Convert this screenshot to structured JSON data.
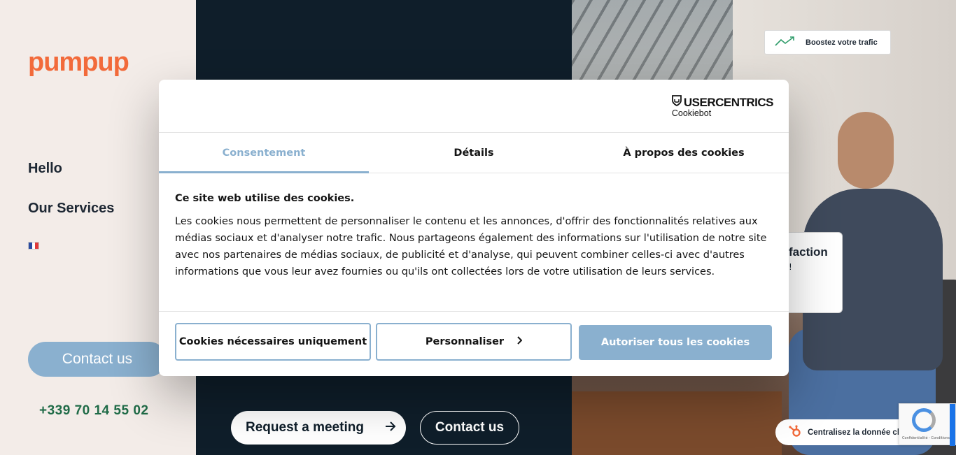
{
  "sidebar": {
    "logo": "pumpup",
    "nav": [
      "Hello",
      "Our Services"
    ],
    "contact_label": "Contact us",
    "phone": "+339 70 14 55 02"
  },
  "hero": {
    "request_meeting_label": "Request a meeting",
    "contact_label": "Contact us"
  },
  "photo_overlays": {
    "trafic_badge": "Boostez votre trafic",
    "satisfaction_title": "faction",
    "satisfaction_sub": "!",
    "centralisez_badge": "Centralisez la donnée cl",
    "recaptcha_text": "Confidentialité - Conditions"
  },
  "cookie_dialog": {
    "brand": "USERCENTRICS",
    "brand_sub": "Cookiebot",
    "tabs": [
      "Consentement",
      "Détails",
      "À propos des cookies"
    ],
    "title": "Ce site web utilise des cookies.",
    "body": "Les cookies nous permettent de personnaliser le contenu et les annonces, d'offrir des fonctionnalités relatives aux médias sociaux et d'analyser notre trafic. Nous partageons également des informations sur l'utilisation de notre site avec nos partenaires de médias sociaux, de publicité et d'analyse, qui peuvent combiner celles-ci avec d'autres informations que vous leur avez fournies ou qu'ils ont collectées lors de votre utilisation de leurs services.",
    "btn_necessary": "Cookies nécessaires uniquement",
    "btn_customize": "Personnaliser",
    "btn_allow": "Autoriser tous les cookies"
  },
  "colors": {
    "brand_orange": "#f26a3a",
    "accent_blue": "#8ab0cf",
    "dark_navy": "#0f1e2a",
    "phone_green": "#1f6b47"
  }
}
